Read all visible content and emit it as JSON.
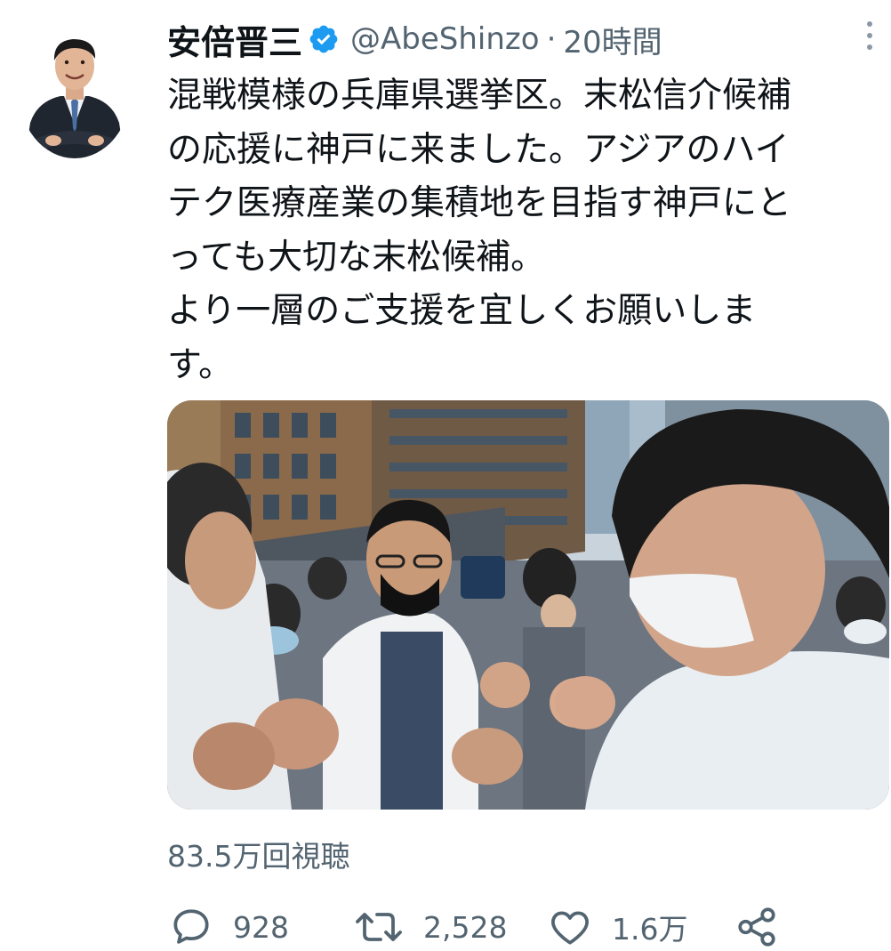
{
  "tweet": {
    "display_name": "安倍晋三",
    "handle": "@AbeShinzo",
    "separator": "·",
    "time": "20時間",
    "body_lines": [
      "混戦模様の兵庫県選挙区。末松信介候補",
      "の応援に神戸に来ました。アジアのハイ",
      "テク医療産業の集積地を目指す神戸にと",
      "っても大切な末松候補。",
      "より一層のご支援を宜しくお願いしま",
      "す。"
    ],
    "views": "83.5万回視聴",
    "actions": {
      "reply_count": "928",
      "retweet_count": "2,528",
      "like_count": "1.6万"
    }
  },
  "colors": {
    "text_primary": "#0f1419",
    "text_secondary": "#536471",
    "verified_blue": "#1d9bf0"
  },
  "icons": {
    "verified": "verified-badge-icon",
    "more": "more-vertical-icon",
    "reply": "speech-bubble-icon",
    "retweet": "retweet-icon",
    "like": "heart-icon",
    "share": "share-icon"
  }
}
